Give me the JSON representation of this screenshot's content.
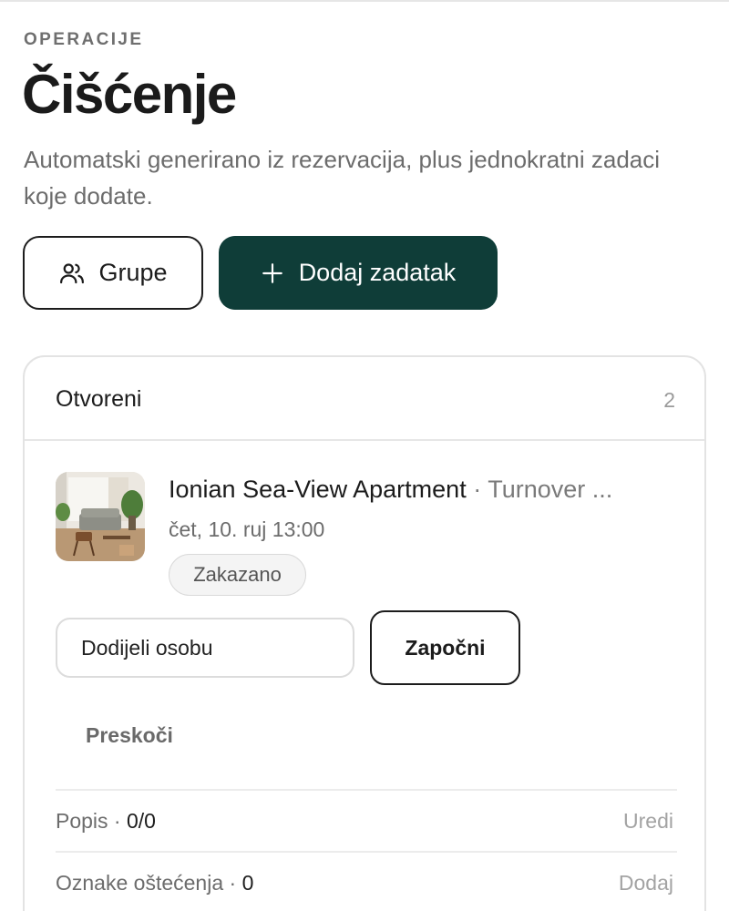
{
  "header": {
    "eyebrow": "OPERACIJE",
    "title": "Čišćenje",
    "subtitle": "Automatski generirano iz rezervacija, plus jednokratni zadaci koje dodate."
  },
  "actions": {
    "groups_label": "Grupe",
    "groups_icon": "users-icon",
    "add_label": "Dodaj zadatak",
    "add_icon": "plus-icon"
  },
  "open_tasks": {
    "title": "Otvoreni",
    "count": "2",
    "task": {
      "property": "Ionian Sea-View Apartment",
      "separator": "·",
      "type": "Turnover ...",
      "time": "čet, 10. ruj 13:00",
      "status": "Zakazano",
      "assign_placeholder": "Dodijeli osobu",
      "start_label": "Započni",
      "skip_label": "Preskoči",
      "checklist": {
        "label": "Popis ·",
        "value": "0/0",
        "action": "Uredi"
      },
      "damage": {
        "label": "Oznake oštećenja ·",
        "value": "0",
        "action": "Dodaj"
      }
    }
  },
  "colors": {
    "primary": "#0f3d38",
    "text": "#1c1c1c",
    "muted": "#6c6c6c",
    "border": "#e3e3e3"
  }
}
